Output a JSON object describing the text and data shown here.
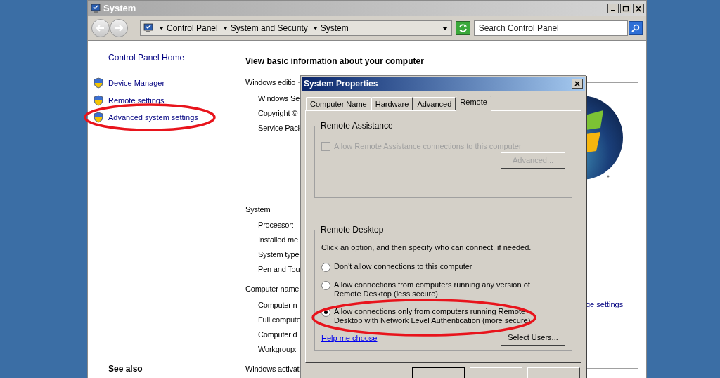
{
  "window": {
    "title": "System"
  },
  "address_bar": {
    "breadcrumbs": [
      "Control Panel",
      "System and Security",
      "System"
    ]
  },
  "search": {
    "placeholder": "Search Control Panel"
  },
  "sidebar": {
    "home": "Control Panel Home",
    "items": [
      {
        "label": "Device Manager"
      },
      {
        "label": "Remote settings"
      },
      {
        "label": "Advanced system settings"
      }
    ],
    "see_also": "See also"
  },
  "main": {
    "heading": "View basic information about your computer",
    "sections": [
      {
        "title": "Windows editio",
        "items": [
          "Windows Se",
          "Copyright ©",
          "Service Pack"
        ]
      },
      {
        "title": "System",
        "items": [
          "Processor:",
          "Installed me",
          "System type",
          "Pen and Tou"
        ]
      },
      {
        "title": "Computer name",
        "items": [
          "Computer n",
          "Full compute",
          "Computer d",
          "Workgroup:"
        ]
      },
      {
        "title": "Windows activat"
      }
    ],
    "change_link": "ge settings"
  },
  "dialog": {
    "title": "System Properties",
    "tabs": [
      {
        "label": "Computer Name",
        "selected": false
      },
      {
        "label": "Hardware",
        "selected": false
      },
      {
        "label": "Advanced",
        "selected": false
      },
      {
        "label": "Remote",
        "selected": true
      }
    ],
    "remote_assistance": {
      "title": "Remote Assistance",
      "checkbox": {
        "label": "Allow Remote Assistance connections to this computer",
        "checked": false,
        "disabled": true
      },
      "button": {
        "label": "Advanced...",
        "disabled": true
      }
    },
    "remote_desktop": {
      "title": "Remote Desktop",
      "instruction": "Click an option, and then specify who can connect, if needed.",
      "options": [
        {
          "label": "Don't allow connections to this computer",
          "selected": false
        },
        {
          "label": "Allow connections from computers running any version of Remote Desktop (less secure)",
          "selected": false
        },
        {
          "label": "Allow connections only from computers running Remote Desktop with Network Level Authentication (more secure)",
          "selected": true
        }
      ],
      "help_link": "Help me choose",
      "button": "Select Users..."
    }
  }
}
